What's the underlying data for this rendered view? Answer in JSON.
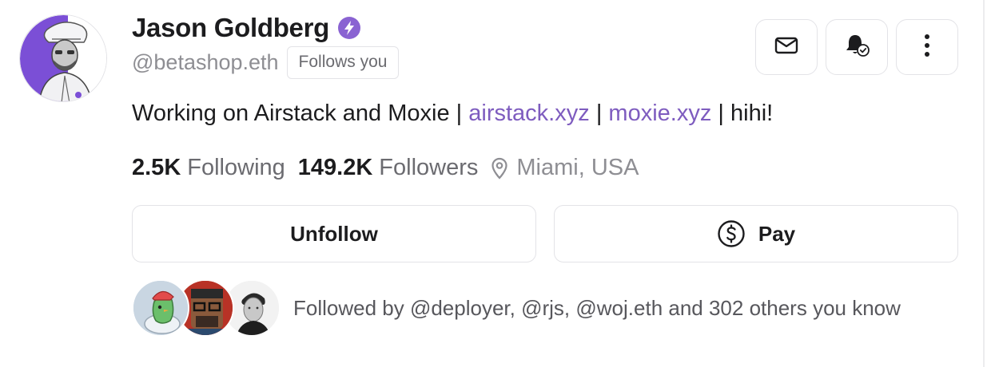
{
  "profile": {
    "name": "Jason Goldberg",
    "handle": "@betashop.eth",
    "follows_you": "Follows you",
    "verified_badge_icon": "power-badge-icon",
    "accent_color": "#8A63D2",
    "bio": {
      "text_before": "Working on Airstack and Moxie",
      "separator": "|",
      "link1": "airstack.xyz",
      "link2": "moxie.xyz",
      "text_after": "hihi!"
    },
    "stats": {
      "following_count": "2.5K",
      "following_label": "Following",
      "followers_count": "149.2K",
      "followers_label": "Followers",
      "location": "Miami, USA"
    }
  },
  "actions": {
    "message_icon": "mail-icon",
    "notify_icon": "bell-check-icon",
    "more_icon": "more-vertical-icon",
    "unfollow_label": "Unfollow",
    "pay_label": "Pay",
    "pay_icon": "dollar-circle-icon"
  },
  "mutuals": {
    "avatars": [
      "mutual-avatar-deployer",
      "mutual-avatar-rjs",
      "mutual-avatar-woj"
    ],
    "text": "Followed by @deployer, @rjs, @woj.eth and 302 others you know"
  }
}
